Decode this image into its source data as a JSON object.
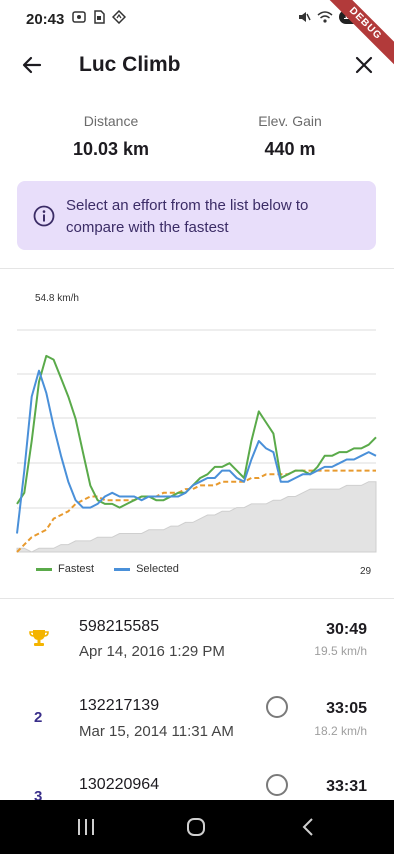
{
  "status": {
    "time": "20:43",
    "battery": "100",
    "debug_label": "DEBUG",
    "left_icons": [
      "screenshot-icon",
      "sim-icon",
      "location-diamond-icon"
    ],
    "right_icons": [
      "mute-icon",
      "wifi-icon",
      "battery-icon"
    ]
  },
  "app_bar": {
    "title": "Luc Climb"
  },
  "stats": {
    "distance_label": "Distance",
    "distance_value": "10.03 km",
    "elev_label": "Elev. Gain",
    "elev_value": "440 m"
  },
  "info": {
    "text": "Select an effort from the list below to compare with the fastest"
  },
  "chart_data": {
    "type": "line",
    "y_top_label": "54.8 km/h",
    "x_end_label": "29",
    "grid": true,
    "legend_position": "bottom-left",
    "series": [
      {
        "name": "Fastest",
        "color": "#5aaa4a",
        "values": [
          13,
          16,
          30,
          46,
          53,
          52,
          47,
          42,
          36,
          27,
          18,
          14,
          13,
          13,
          12,
          13,
          14,
          15,
          15,
          14,
          14,
          15,
          16,
          16,
          18,
          20,
          21,
          23,
          23,
          24,
          22,
          20,
          30,
          38,
          35,
          32,
          20,
          21,
          22,
          22,
          21,
          23,
          26,
          26,
          27,
          27,
          28,
          28,
          29,
          31
        ]
      },
      {
        "name": "Selected",
        "color": "#4a90d9",
        "values": [
          5,
          22,
          42,
          49,
          43,
          34,
          26,
          19,
          14,
          12,
          12,
          13,
          15,
          16,
          15,
          15,
          15,
          14,
          15,
          15,
          15,
          15,
          15,
          16,
          18,
          19,
          20,
          20,
          22,
          22,
          20,
          19,
          25,
          30,
          28,
          27,
          19,
          19,
          20,
          21,
          21,
          22,
          23,
          23,
          24,
          25,
          25,
          26,
          27,
          26
        ]
      },
      {
        "name": "",
        "color": "#e89a2e",
        "values": [
          0,
          2,
          4,
          5,
          6,
          9,
          10,
          11,
          13,
          14,
          15,
          15,
          14,
          14,
          14,
          14,
          14,
          15,
          15,
          15,
          16,
          16,
          16,
          17,
          17,
          18,
          18,
          18,
          19,
          19,
          19,
          19,
          20,
          20,
          21,
          21,
          21,
          21,
          22,
          22,
          22,
          22,
          22,
          22,
          22,
          22,
          22,
          22,
          22,
          22
        ]
      },
      {
        "name": "",
        "color": "#e3e3e3",
        "values": [
          1,
          1,
          0,
          1,
          1,
          1,
          2,
          2,
          3,
          3,
          3,
          4,
          4,
          4,
          5,
          5,
          5,
          5,
          6,
          6,
          6,
          7,
          7,
          8,
          8,
          9,
          10,
          10,
          11,
          11,
          12,
          12,
          13,
          13,
          13,
          14,
          14,
          15,
          15,
          16,
          17,
          17,
          17,
          17,
          17,
          18,
          18,
          18,
          19,
          19
        ]
      }
    ]
  },
  "legend": {
    "fastest_label": "Fastest",
    "selected_label": "Selected",
    "fastest_color": "#5aaa4a",
    "selected_color": "#4a90d9"
  },
  "efforts": [
    {
      "rank": "",
      "id": "598215585",
      "date": "Apr 14, 2016 1:29 PM",
      "time": "30:49",
      "speed": "19.5 km/h",
      "is_fastest": true
    },
    {
      "rank": "2",
      "id": "132217139",
      "date": "Mar 15, 2014 11:31 AM",
      "time": "33:05",
      "speed": "18.2 km/h",
      "is_fastest": false
    },
    {
      "rank": "3",
      "id": "130220964",
      "date": "",
      "time": "33:31",
      "speed": "",
      "is_fastest": false
    }
  ]
}
